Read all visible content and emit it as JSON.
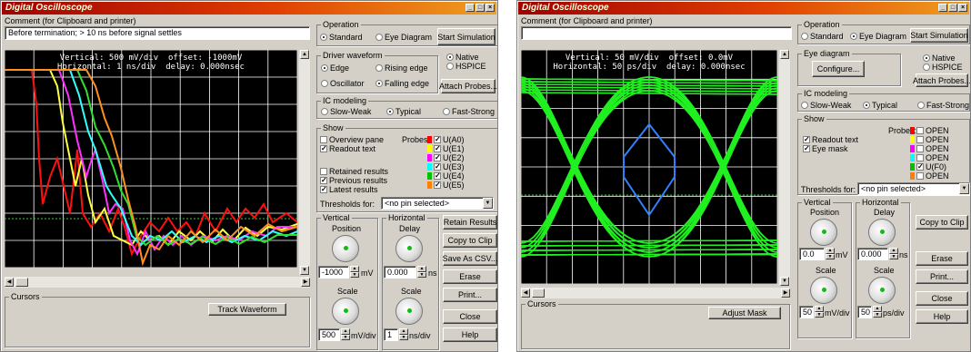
{
  "left": {
    "title": "Digital Oscilloscope",
    "comment_label": "Comment (for Clipboard and printer)",
    "comment_value": "Before termination; > 10 ns before signal settles",
    "readout_line1": "Vertical: 500 mV/div  offset: -1000mV",
    "readout_line2": "Horizontal: 1 ns/div  delay: 0.000nsec",
    "operation": {
      "label": "Operation",
      "standard": "Standard",
      "eye": "Eye Diagram",
      "start": "Start Simulation"
    },
    "driver": {
      "label": "Driver waveform",
      "edge": "Edge",
      "rising": "Rising edge",
      "osc": "Oscillator",
      "falling": "Falling edge",
      "attach": "Attach Probes..."
    },
    "engine": {
      "native": "Native",
      "hspice": "HSPICE"
    },
    "ic": {
      "label": "IC modeling",
      "slow": "Slow-Weak",
      "typical": "Typical",
      "fast": "Fast-Strong"
    },
    "show": {
      "label": "Show",
      "overview": "Overview pane",
      "readout": "Readout text",
      "retained": "Retained results",
      "previous": "Previous results",
      "latest": "Latest results",
      "probes_label": "Probes:",
      "thresholds": "Thresholds for:",
      "thresholds_value": "<no pin selected>"
    },
    "probes": [
      {
        "name": "U(A0)",
        "color": "#ff0000"
      },
      {
        "name": "U(E1)",
        "color": "#ffff00"
      },
      {
        "name": "U(E2)",
        "color": "#ff00ff"
      },
      {
        "name": "U(E3)",
        "color": "#00ffff"
      },
      {
        "name": "U(E4)",
        "color": "#00c000"
      },
      {
        "name": "U(E5)",
        "color": "#ff8000"
      }
    ],
    "vertical": {
      "label": "Vertical",
      "pos": "Position",
      "pos_value": "-1000",
      "pos_unit": "mV",
      "scale": "Scale",
      "scale_value": "500",
      "scale_unit": "mV/div"
    },
    "horizontal": {
      "label": "Horizontal",
      "delay": "Delay",
      "delay_value": "0.000",
      "delay_unit": "ns",
      "scale": "Scale",
      "scale_value": "1",
      "scale_unit": "ns/div"
    },
    "buttons": {
      "retain": "Retain Results",
      "copy": "Copy to Clip",
      "csv": "Save As CSV...",
      "erase": "Erase",
      "print": "Print...",
      "close": "Close",
      "help": "Help"
    },
    "cursors_label": "Cursors",
    "track": "Track Waveform"
  },
  "right": {
    "title": "Digital Oscilloscope",
    "comment_label": "Comment (for Clipboard and printer)",
    "comment_value": "",
    "readout_line1": "Vertical: 50 mV/div  offset: 0.0mV",
    "readout_line2": "Horizontal: 50 ps/div  delay: 0.000nsec",
    "operation": {
      "label": "Operation",
      "standard": "Standard",
      "eye": "Eye Diagram",
      "start": "Start Simulation"
    },
    "engine": {
      "native": "Native",
      "hspice": "HSPICE"
    },
    "eye": {
      "label": "Eye diagram",
      "configure": "Configure...",
      "attach": "Attach Probes..."
    },
    "ic": {
      "label": "IC modeling",
      "slow": "Slow-Weak",
      "typical": "Typical",
      "fast": "Fast-Strong"
    },
    "show": {
      "label": "Show",
      "readout": "Readout text",
      "mask": "Eye mask",
      "probes_label": "Probes:",
      "thresholds": "Thresholds for:",
      "thresholds_value": "<no pin selected>"
    },
    "probes": [
      {
        "name": "OPEN",
        "color": "#ff0000",
        "checked": false
      },
      {
        "name": "OPEN",
        "color": "#ffff00",
        "checked": false
      },
      {
        "name": "OPEN",
        "color": "#ff00ff",
        "checked": false
      },
      {
        "name": "OPEN",
        "color": "#00ffff",
        "checked": false
      },
      {
        "name": "U(F0)",
        "color": "#00c000",
        "checked": true
      },
      {
        "name": "OPEN",
        "color": "#ff8000",
        "checked": false
      }
    ],
    "vertical": {
      "label": "Vertical",
      "pos": "Position",
      "pos_value": "0.0",
      "pos_unit": "mV",
      "scale": "Scale",
      "scale_value": "50",
      "scale_unit": "mV/div"
    },
    "horizontal": {
      "label": "Horizontal",
      "delay": "Delay",
      "delay_value": "0.000",
      "delay_unit": "ns",
      "scale": "Scale",
      "scale_value": "50",
      "scale_unit": "ps/div"
    },
    "buttons": {
      "copy": "Copy to Clip",
      "erase": "Erase",
      "print": "Print...",
      "close": "Close",
      "help": "Help"
    },
    "cursors_label": "Cursors",
    "adjust": "Adjust Mask"
  }
}
